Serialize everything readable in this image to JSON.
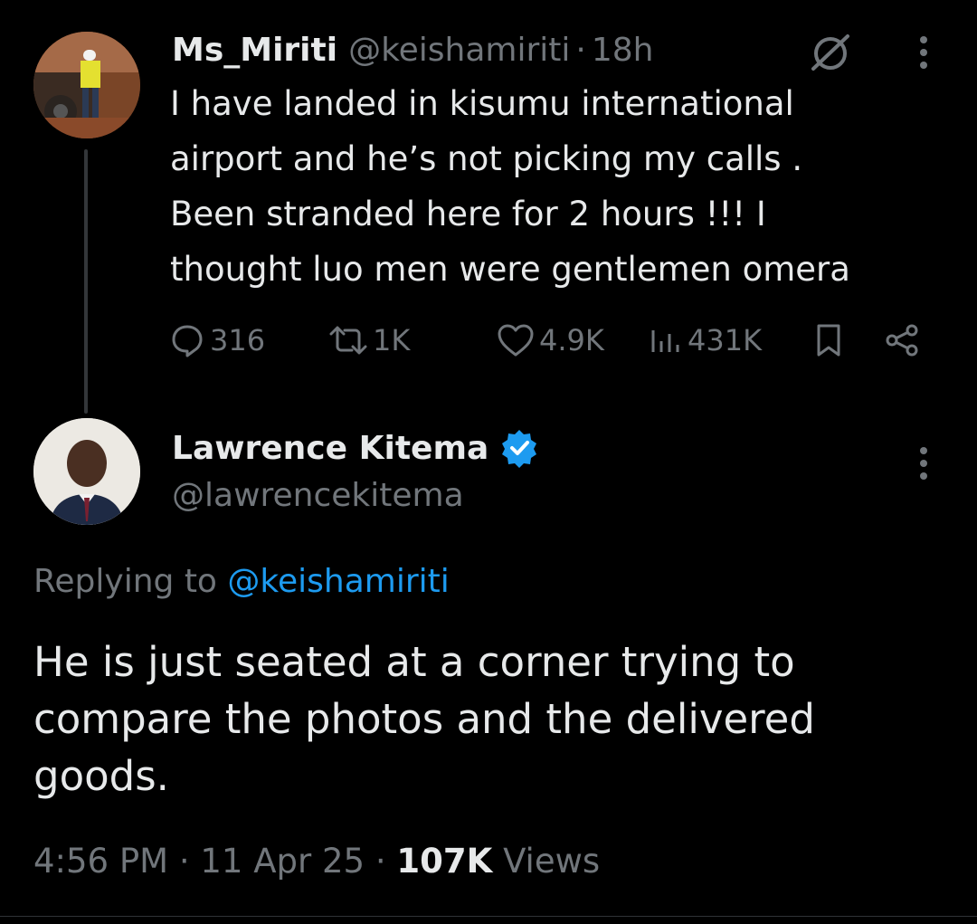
{
  "parent_tweet": {
    "display_name": "Ms_Miriti",
    "handle": "@keishamiriti",
    "separator": "·",
    "time": "18h",
    "text": "I have landed in kisumu international\nairport and he’s not picking my calls .\nBeen stranded here for 2 hours !!! I\nthought luo men were gentlemen omera",
    "actions": {
      "replies": "316",
      "reposts": "1K",
      "likes": "4.9K",
      "views": "431K"
    },
    "icons": [
      "grok-icon",
      "more-icon",
      "reply-icon",
      "repost-icon",
      "like-icon",
      "views-icon",
      "bookmark-icon",
      "share-icon"
    ]
  },
  "reply_tweet": {
    "display_name": "Lawrence Kitema",
    "handle": "@lawrencekitema",
    "verified_color": "#1d9bf0",
    "replying_prefix": "Replying to",
    "replying_handle": "@keishamiriti",
    "text": "He is just seated at a corner trying to\ncompare the photos and the delivered\ngoods.",
    "timestamp": "4:56 PM",
    "sep1": "·",
    "date": "11 Apr 25",
    "sep2": "·",
    "views_count": "107K",
    "views_label": "Views"
  },
  "colors": {
    "background": "#000000",
    "text_primary": "#e7e9ea",
    "text_secondary": "#71767b",
    "link": "#1d9bf0"
  }
}
